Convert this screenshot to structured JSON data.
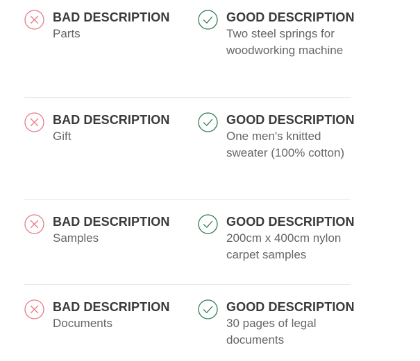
{
  "colors": {
    "bad_icon": "#e8798a",
    "good_icon": "#2e7d4f",
    "heading": "#3a3a3a",
    "text": "#666666",
    "divider": "#e6e6e6"
  },
  "rows": [
    {
      "bad": {
        "icon": "x-circle-icon",
        "heading": "BAD DESCRIPTION",
        "text": "Parts"
      },
      "good": {
        "icon": "check-circle-icon",
        "heading": "GOOD DESCRIPTION",
        "text": "Two steel springs for woodworking machine"
      }
    },
    {
      "bad": {
        "icon": "x-circle-icon",
        "heading": "BAD DESCRIPTION",
        "text": "Gift"
      },
      "good": {
        "icon": "check-circle-icon",
        "heading": "GOOD DESCRIPTION",
        "text": "One men's knitted sweater (100% cotton)"
      }
    },
    {
      "bad": {
        "icon": "x-circle-icon",
        "heading": "BAD DESCRIPTION",
        "text": "Samples"
      },
      "good": {
        "icon": "check-circle-icon",
        "heading": "GOOD DESCRIPTION",
        "text": "200cm x 400cm nylon carpet samples"
      }
    },
    {
      "bad": {
        "icon": "x-circle-icon",
        "heading": "BAD DESCRIPTION",
        "text": "Documents"
      },
      "good": {
        "icon": "check-circle-icon",
        "heading": "GOOD DESCRIPTION",
        "text": "30 pages of legal documents"
      }
    }
  ]
}
